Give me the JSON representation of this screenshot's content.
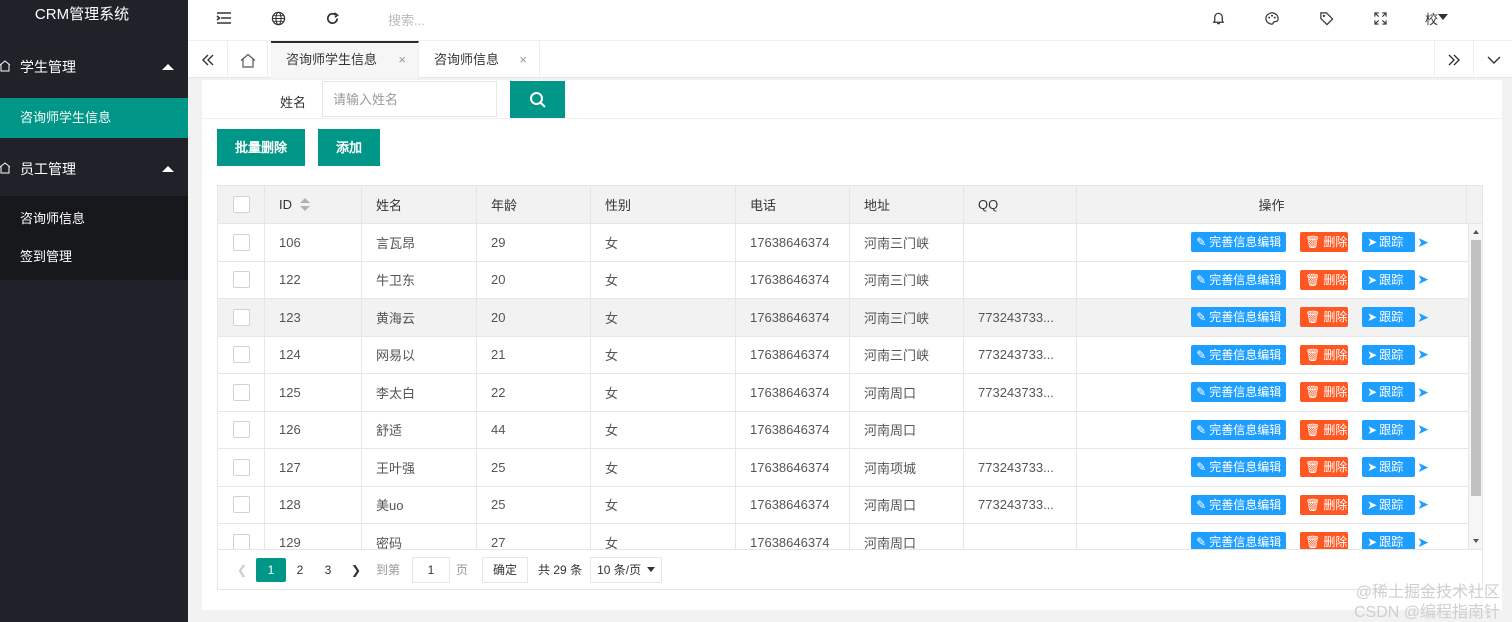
{
  "app": {
    "title": "CRM管理系统"
  },
  "sidebar": {
    "groups": [
      {
        "label": "学生管理",
        "items": [
          {
            "label": "咨询师学生信息",
            "active": true
          }
        ]
      },
      {
        "label": "员工管理",
        "items": [
          {
            "label": "咨询师信息"
          },
          {
            "label": "签到管理"
          }
        ]
      }
    ]
  },
  "header": {
    "search_placeholder": "搜索...",
    "user": "校",
    "icons": [
      "menu-toggle-icon",
      "globe-icon",
      "refresh-icon",
      "bell-icon",
      "theme-icon",
      "tag-icon",
      "fullscreen-icon"
    ]
  },
  "tabs": [
    {
      "label": "咨询师学生信息",
      "active": true
    },
    {
      "label": "咨询师信息",
      "active": false
    }
  ],
  "search": {
    "label": "姓名",
    "placeholder": "请输入姓名",
    "value": ""
  },
  "toolbar": {
    "batch_delete": "批量删除",
    "add": "添加"
  },
  "table": {
    "columns": [
      "ID",
      "姓名",
      "年龄",
      "性别",
      "电话",
      "地址",
      "QQ",
      "操作"
    ],
    "actions": {
      "edit": "完善信息编辑",
      "delete": "删除",
      "track": "跟踪"
    },
    "rows": [
      {
        "id": "106",
        "name": "言瓦昂",
        "age": "29",
        "sex": "女",
        "phone": "17638646374",
        "addr": "河南三门峡",
        "qq": ""
      },
      {
        "id": "122",
        "name": "牛卫东",
        "age": "20",
        "sex": "女",
        "phone": "17638646374",
        "addr": "河南三门峡",
        "qq": ""
      },
      {
        "id": "123",
        "name": "黄海云",
        "age": "20",
        "sex": "女",
        "phone": "17638646374",
        "addr": "河南三门峡",
        "qq": "773243733..."
      },
      {
        "id": "124",
        "name": "网易以",
        "age": "21",
        "sex": "女",
        "phone": "17638646374",
        "addr": "河南三门峡",
        "qq": "773243733..."
      },
      {
        "id": "125",
        "name": "李太白",
        "age": "22",
        "sex": "女",
        "phone": "17638646374",
        "addr": "河南周口",
        "qq": "773243733..."
      },
      {
        "id": "126",
        "name": "舒适",
        "age": "44",
        "sex": "女",
        "phone": "17638646374",
        "addr": "河南周口",
        "qq": ""
      },
      {
        "id": "127",
        "name": "王叶强",
        "age": "25",
        "sex": "女",
        "phone": "17638646374",
        "addr": "河南项城",
        "qq": "773243733..."
      },
      {
        "id": "128",
        "name": "美uo",
        "age": "25",
        "sex": "女",
        "phone": "17638646374",
        "addr": "河南周口",
        "qq": "773243733..."
      },
      {
        "id": "129",
        "name": "密码",
        "age": "27",
        "sex": "女",
        "phone": "17638646374",
        "addr": "河南周口",
        "qq": ""
      }
    ]
  },
  "pagination": {
    "pages": [
      "1",
      "2",
      "3"
    ],
    "current": "1",
    "goto_label": "到第",
    "goto_value": "1",
    "page_unit": "页",
    "confirm": "确定",
    "total": "共 29 条",
    "page_size": "10 条/页"
  },
  "watermark": {
    "line1": "@稀土掘金技术社区",
    "line2": "CSDN @编程指南针"
  }
}
